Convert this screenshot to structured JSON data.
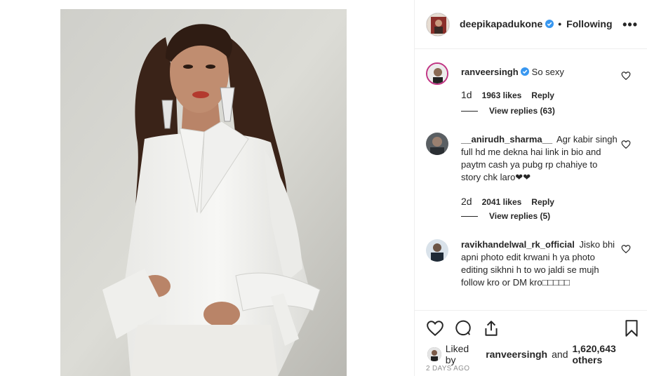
{
  "post": {
    "username": "deepikapadukone",
    "follow_status": "Following",
    "more": "•••"
  },
  "comments": [
    {
      "username": "ranveersingh",
      "text": "So sexy",
      "time": "1d",
      "likes": "1963 likes",
      "reply": "Reply",
      "view_replies": "View replies (63)"
    },
    {
      "username": "__anirudh_sharma__",
      "text": "Agr kabir singh full hd me dekna hai link in bio and paytm cash ya pubg rp chahiye to story chk laro❤❤",
      "time": "2d",
      "likes": "2041 likes",
      "reply": "Reply",
      "view_replies": "View replies (5)"
    },
    {
      "username": "ravikhandelwal_rk_official",
      "text": "Jisko bhi apni photo edit krwani h ya photo editing sikhni h to wo jaldi se mujh follow kro or DM kro□□□□□"
    }
  ],
  "likes": {
    "prefix": "Liked by",
    "user": "ranveersingh",
    "joiner": "and",
    "others": "1,620,643 others"
  },
  "post_time": "2 DAYS AGO",
  "icons": {
    "verified": "verified-badge-icon",
    "like": "heart-icon",
    "comment": "comment-icon",
    "share": "share-icon",
    "save": "bookmark-icon"
  },
  "colors": {
    "verified": "#3897f0",
    "text": "#262626",
    "muted": "#8e8e8e",
    "border": "#efefef"
  }
}
